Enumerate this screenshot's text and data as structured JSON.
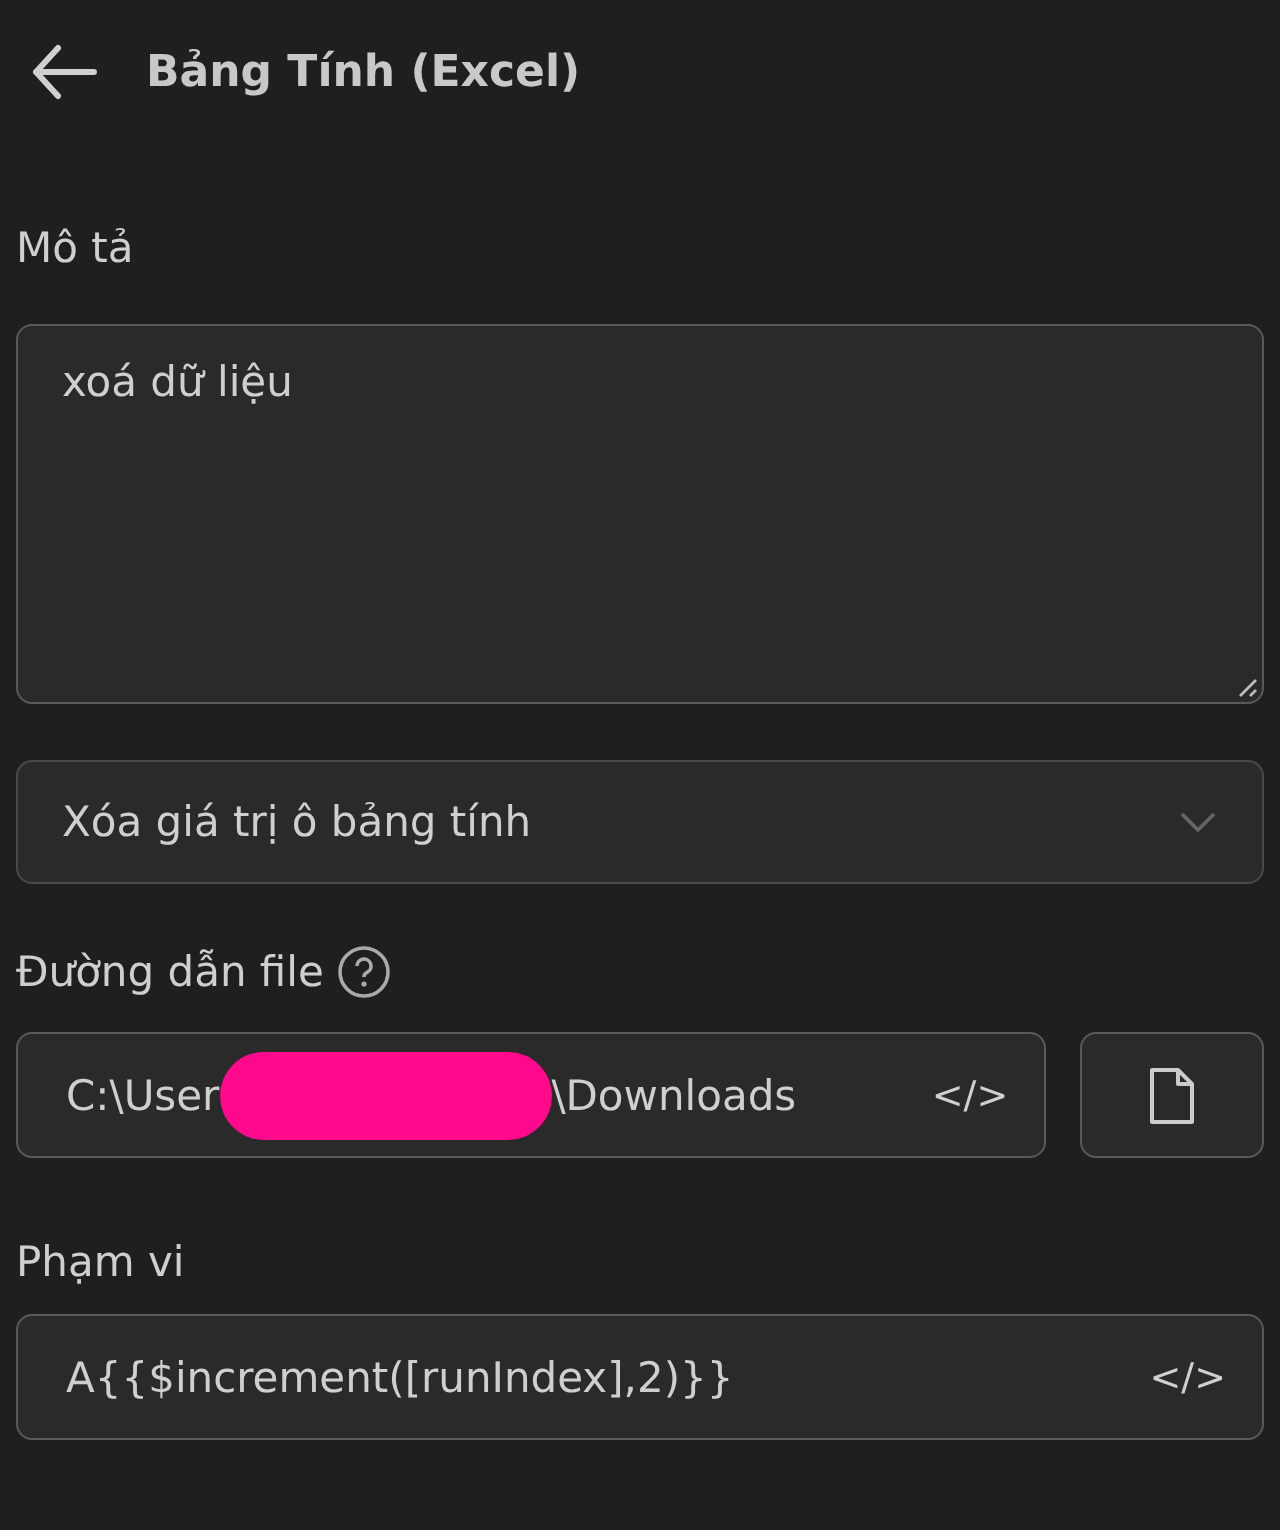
{
  "header": {
    "title": "Bảng Tính (Excel)"
  },
  "description": {
    "label": "Mô tả",
    "value": "xoá dữ liệu"
  },
  "action_select": {
    "value": "Xóa giá trị ô bảng tính"
  },
  "file_path": {
    "label": "Đường dẫn file",
    "value_start": "C:\\User",
    "value_end": "\\Downloads",
    "redacted": true,
    "code_toggle": "</>"
  },
  "range": {
    "label": "Phạm vi",
    "value": "A{{$increment([runIndex],2)}}",
    "code_toggle": "</>"
  }
}
